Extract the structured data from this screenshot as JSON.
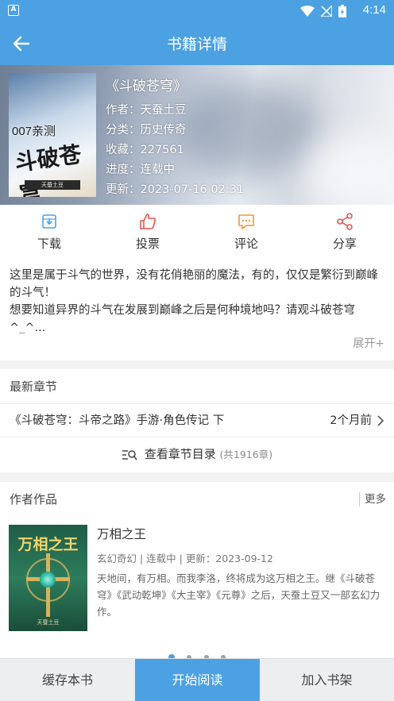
{
  "status_bar": {
    "time": "4:14",
    "app_badge": "A"
  },
  "app_bar": {
    "title": "书籍详情"
  },
  "book": {
    "title": "《斗破苍穹》",
    "author_line": "作者：天蚕土豆",
    "category_line": "分类：历史传奇",
    "favorites_line": "收藏：227561",
    "progress_line": "进度：连载中",
    "updated_line": "更新：2023-07-16 02:31",
    "cover_tag": "007亲测",
    "cover_title": "斗破苍穹",
    "cover_author": "天蚕土豆"
  },
  "actions": [
    {
      "label": "下载",
      "icon": "download-icon"
    },
    {
      "label": "投票",
      "icon": "thumbs-up-icon"
    },
    {
      "label": "评论",
      "icon": "comment-icon"
    },
    {
      "label": "分享",
      "icon": "share-icon"
    }
  ],
  "intro": {
    "text": "这里是属于斗气的世界，没有花俏艳丽的魔法，有的，仅仅是繁衍到巅峰的斗气！\n想要知道异界的斗气在发展到巅峰之后是何种境地吗？请观斗破苍穹^_^...",
    "expand_label": "展开+"
  },
  "latest": {
    "heading": "最新章节",
    "chapter": "《斗破苍穹：斗帝之路》手游·角色传记 下",
    "ago": "2个月前",
    "catalog_label": "查看章节目录",
    "catalog_count": "(共1916章)"
  },
  "works": {
    "heading": "作者作品",
    "more_label": "更多",
    "item": {
      "name": "万相之王",
      "meta": "玄幻奇幻 | 连载中 | 更新：2023-09-12",
      "desc": "天地间，有万相。而我李洛，终将成为这万相之王。继《斗破苍穹》《武动乾坤》《大主宰》《元尊》之后，天蚕土豆又一部玄幻力作。",
      "cover_title": "万相之王",
      "cover_author": "天蚕土豆"
    },
    "carousel_active_index": 0,
    "carousel_count": 4
  },
  "bottom_bar": {
    "cache_label": "缓存本书",
    "start_label": "开始阅读",
    "shelf_label": "加入书架"
  },
  "colors": {
    "primary": "#4ba1e2",
    "action_icon_blue": "#4ba1e2",
    "action_icon_red": "#e8534f",
    "action_icon_orange": "#f0963a",
    "action_icon_share": "#e8534f"
  }
}
